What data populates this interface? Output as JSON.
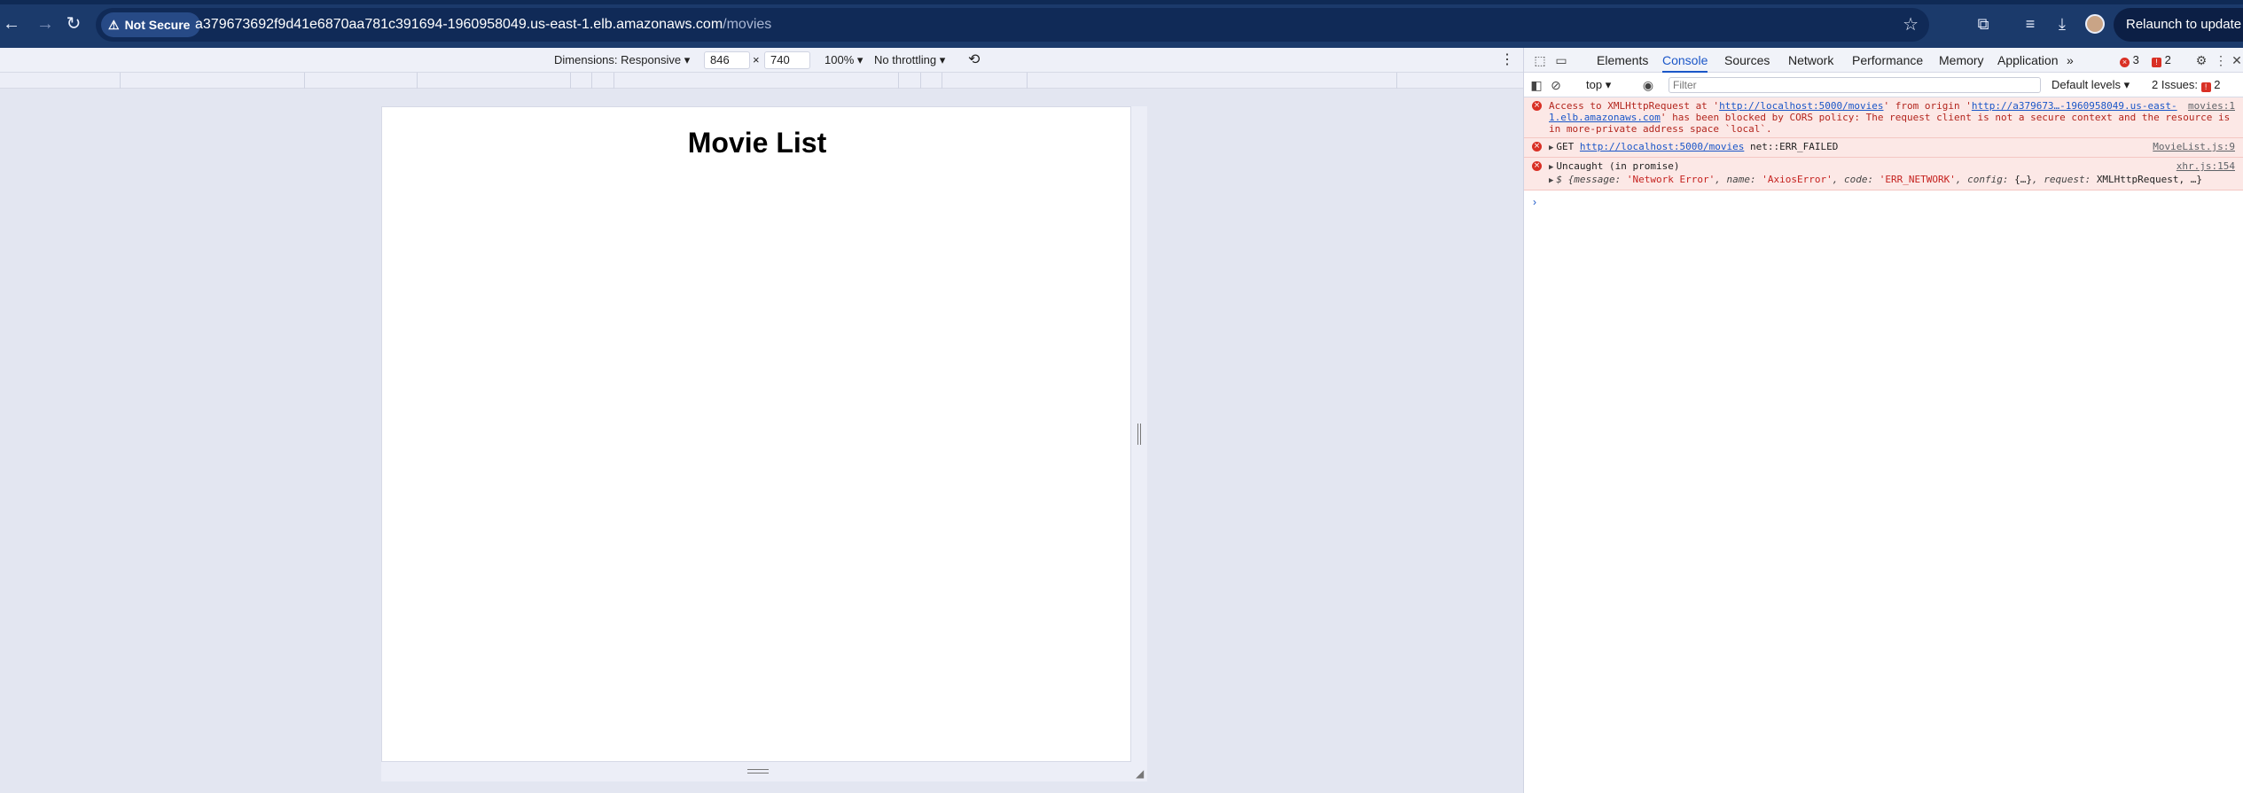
{
  "browser": {
    "not_secure_label": "Not Secure",
    "url_host": "a379673692f9d41e6870aa781c391694-1960958049.us-east-1.elb.amazonaws.com",
    "url_path": "/movies",
    "relaunch_label": "Relaunch to update"
  },
  "device_toolbar": {
    "dimensions_label": "Dimensions: Responsive",
    "width": "846",
    "times": "×",
    "height": "740",
    "zoom": "100%",
    "throttling": "No throttling"
  },
  "page": {
    "title": "Movie List"
  },
  "devtools": {
    "tabs": [
      "Elements",
      "Console",
      "Sources",
      "Network",
      "Performance",
      "Memory",
      "Application"
    ],
    "active_tab": "Console",
    "more_tabs": "»",
    "error_count": "3",
    "warning_count": "2",
    "context": "top",
    "filter_placeholder": "Filter",
    "levels": "Default levels",
    "issues_label": "2 Issues:",
    "issues_count": "2"
  },
  "console": {
    "msg1": {
      "part1": "Access to XMLHttpRequest at '",
      "link1": "http://localhost:5000/movies",
      "part2": "' from origin '",
      "link2": "http://a379673…-1960958049.us-east-1.elb.amazonaws.com",
      "part3": "' has been blocked by CORS policy: The request client is not a secure context and the resource is in more-private address space `local`.",
      "source": "movies:1"
    },
    "msg2": {
      "method": "GET",
      "link": "http://localhost:5000/movies",
      "status": "net::ERR_FAILED",
      "source": "MovieList.js:9"
    },
    "msg3": {
      "text": "Uncaught (in promise)",
      "source": "xhr.js:154",
      "detail_prefix": "$ {",
      "k_message": "message",
      "v_message": "'Network Error'",
      "k_name": "name",
      "v_name": "'AxiosError'",
      "k_code": "code",
      "v_code": "'ERR_NETWORK'",
      "k_config": "config",
      "v_config": "{…}",
      "k_request": "request",
      "v_request": "XMLHttpRequest, …}"
    }
  },
  "icons": [
    "back-arrow-icon",
    "forward-arrow-icon",
    "reload-icon",
    "warning-icon",
    "star-icon",
    "extensions-icon",
    "media-icon",
    "download-icon",
    "avatar",
    "menu-icon",
    "rotate-icon",
    "inspect-icon",
    "device-icon",
    "gear-icon",
    "close-icon",
    "sidebar-icon",
    "clear-icon",
    "eye-icon"
  ]
}
